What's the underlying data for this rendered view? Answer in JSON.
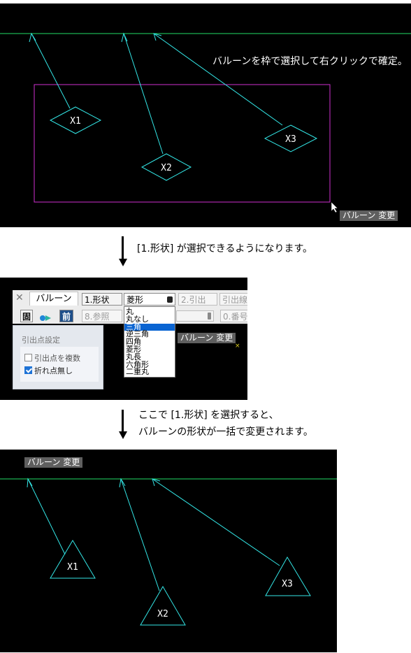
{
  "colors": {
    "background": "#000000",
    "baseline": "#22dd66",
    "leader": "#33e6e6",
    "balloon": "#33e6e6",
    "frame": "#d030d0",
    "label": "#ffffff",
    "status_tag": "#5f5f5f"
  },
  "panel1": {
    "instruction": "バルーンを枠で選択して右クリックで確定。",
    "status_tag": "バルーン 変更",
    "balloons": [
      {
        "label": "X1",
        "shape": "diamond"
      },
      {
        "label": "X2",
        "shape": "diamond"
      },
      {
        "label": "X3",
        "shape": "diamond"
      }
    ]
  },
  "step1_caption": "[1.形状] が選択できるようになります。",
  "toolbar": {
    "close_icon": "close-icon",
    "tab_label": "バルーン",
    "shape_button_label": "1.形状",
    "shape_select_value": "菱形",
    "leader_button_label": "2.引出",
    "leader_line_label": "引出線",
    "fix_button_label": "固",
    "arrows_icon": "arrows-icon",
    "prev_button_label": "前",
    "ref_button_label": "8.参照",
    "number_button_label": "0.番号",
    "dropdown_options": [
      "丸",
      "丸なし",
      "三角",
      "逆三角",
      "四角",
      "菱形",
      "丸長",
      "六角形",
      "二重丸"
    ],
    "dropdown_selected": "三角",
    "panel_title": "引出点設定",
    "checkbox_multi_label": "引出点を複数",
    "checkbox_multi_checked": false,
    "checkbox_nobend_label": "折れ点無し",
    "checkbox_nobend_checked": true,
    "status_tag": "バルーン 変更"
  },
  "step2_caption": {
    "line1": "ここで [1.形状] を選択すると、",
    "line2": "バルーンの形状が一括で変更されます。"
  },
  "panel3": {
    "status_tag": "バルーン 変更",
    "balloons": [
      {
        "label": "X1",
        "shape": "triangle"
      },
      {
        "label": "X2",
        "shape": "triangle"
      },
      {
        "label": "X3",
        "shape": "triangle"
      }
    ]
  }
}
